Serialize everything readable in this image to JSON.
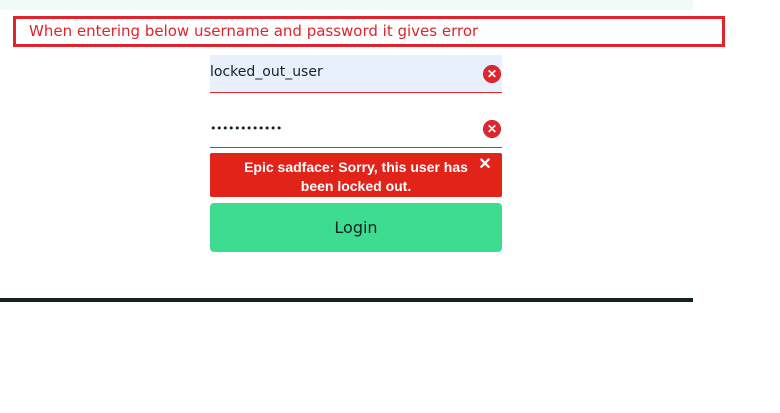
{
  "annotation": {
    "text": "When entering below username and password it gives error",
    "color": "#e0232c"
  },
  "login_form": {
    "username_value": "locked_out_user",
    "password_value": "••••••••••••",
    "field_error_icon": "error-circle-icon",
    "error_message": "Epic sadface: Sorry, this user has been locked out.",
    "error_close_glyph": "✕",
    "login_label": "Login",
    "colors": {
      "error": "#e2231a",
      "login_button": "#3ddc91",
      "username_autofill_bg": "#e8f0fe"
    }
  }
}
